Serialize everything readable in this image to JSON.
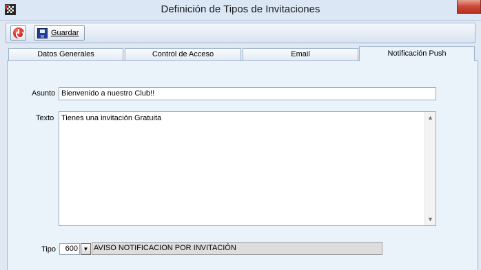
{
  "window": {
    "title": "Definición de Tipos de Invitaciones"
  },
  "toolbar": {
    "save_label": "Guardar"
  },
  "tabs": [
    {
      "label": "Datos Generales",
      "active": false
    },
    {
      "label": "Control de Acceso",
      "active": false
    },
    {
      "label": "Email",
      "active": false
    },
    {
      "label": "Notificación Push",
      "active": true
    }
  ],
  "form": {
    "asunto_label": "Asunto",
    "asunto_value": "Bienvenido a nuestro Club!!",
    "texto_label": "Texto",
    "texto_value": "Tienes una invitación Gratuita",
    "tipo_label": "Tipo",
    "tipo_code": "600",
    "tipo_description": "AVISO NOTIFICACION POR INVITACIÓN"
  },
  "icons": {
    "app": "app-logo-icon",
    "exit": "power-icon",
    "save": "floppy-disk-icon",
    "dropdown": "chevron-down-icon",
    "scroll_up": "scroll-up-arrow-icon",
    "scroll_down": "scroll-down-arrow-icon"
  },
  "colors": {
    "window_background": "#dfe8f3",
    "panel_background": "#eaf2fa",
    "close_button": "#c9483a",
    "exit_icon": "#d0201a",
    "save_icon": "#1f3f9a"
  }
}
